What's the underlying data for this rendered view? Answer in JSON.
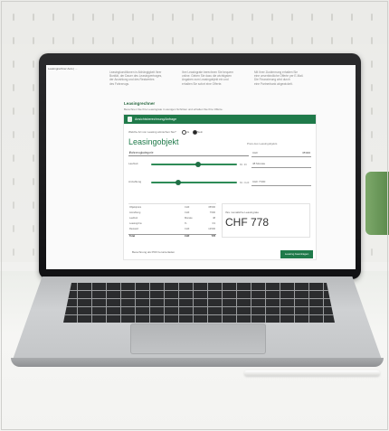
{
  "screen": {
    "tab_title": "Leasingrechner Auto | ...",
    "intro_columns": [
      [
        "Leasingkonditionen in Abhängigkeit Ihrer",
        "Bonität, der Dauer des Leasingvertrages,",
        "der Anzahlung und des Restwertes",
        "des Fahrzeugs."
      ],
      [
        "Ihre Leasingrate berechnen Sie bequem",
        "online. Geben Sie dazu die wichtigsten",
        "Angaben zum Leasingobjekt ein und",
        "erhalten Sie sofort eine Offerte."
      ],
      [
        "Mit Ihrer Zustimmung erhalten Sie",
        "eine unverbindliche Offerte per E-Mail.",
        "Die Finanzierung wird durch",
        "eine Partnerbank abgewickelt."
      ]
    ],
    "section_heading": "Leasingrechner",
    "section_hint": "Berechnen Sie Ihre Leasingrate in wenigen Schritten und erhalten Sie Ihre Offerte.",
    "panel_title": "Ansichtsberechnung/Anfrage",
    "radio_label": "Welche Art von Leasing wünschen Sie?",
    "radio_options": [
      "Ja",
      "Nein"
    ],
    "title": "Leasingobjekt",
    "right_label": "Preis des Leasingobjekts",
    "select_value": "Fahrzeugkategorie",
    "price_field": {
      "label": "CHF",
      "value": "35'000"
    },
    "slider1_label": "Laufzeit",
    "slider1_side": "Mt. 36",
    "slider1_value": "48 Monate",
    "slider2_label": "Anzahlung",
    "slider2_side": "Mt. CHF",
    "slider2_value": "CHF 7'000",
    "summary_rows": [
      [
        "Objektpreis",
        "CHF",
        "35'000"
      ],
      [
        "Anzahlung",
        "CHF",
        "7'000"
      ],
      [
        "Laufzeit",
        "Monate",
        "48"
      ],
      [
        "Leasingzins",
        "%",
        "3.9"
      ],
      [
        "Restwert",
        "CHF",
        "12'000"
      ],
      [
        "Total",
        "CHF",
        "778"
      ]
    ],
    "rate_label": "Ihre monatliche Leasingrate",
    "rate_value": "CHF 778",
    "footer_link": "Berechnung als PDF herunterladen",
    "submit_label": "Leasing beantragen"
  },
  "ui_state": {
    "slider1_fraction": 0.55,
    "slider2_fraction": 0.32
  },
  "colors": {
    "brand_green": "#1f7a4a",
    "laptop_bezel": "#1a1a1c",
    "pegboard": "#ebebe8"
  }
}
